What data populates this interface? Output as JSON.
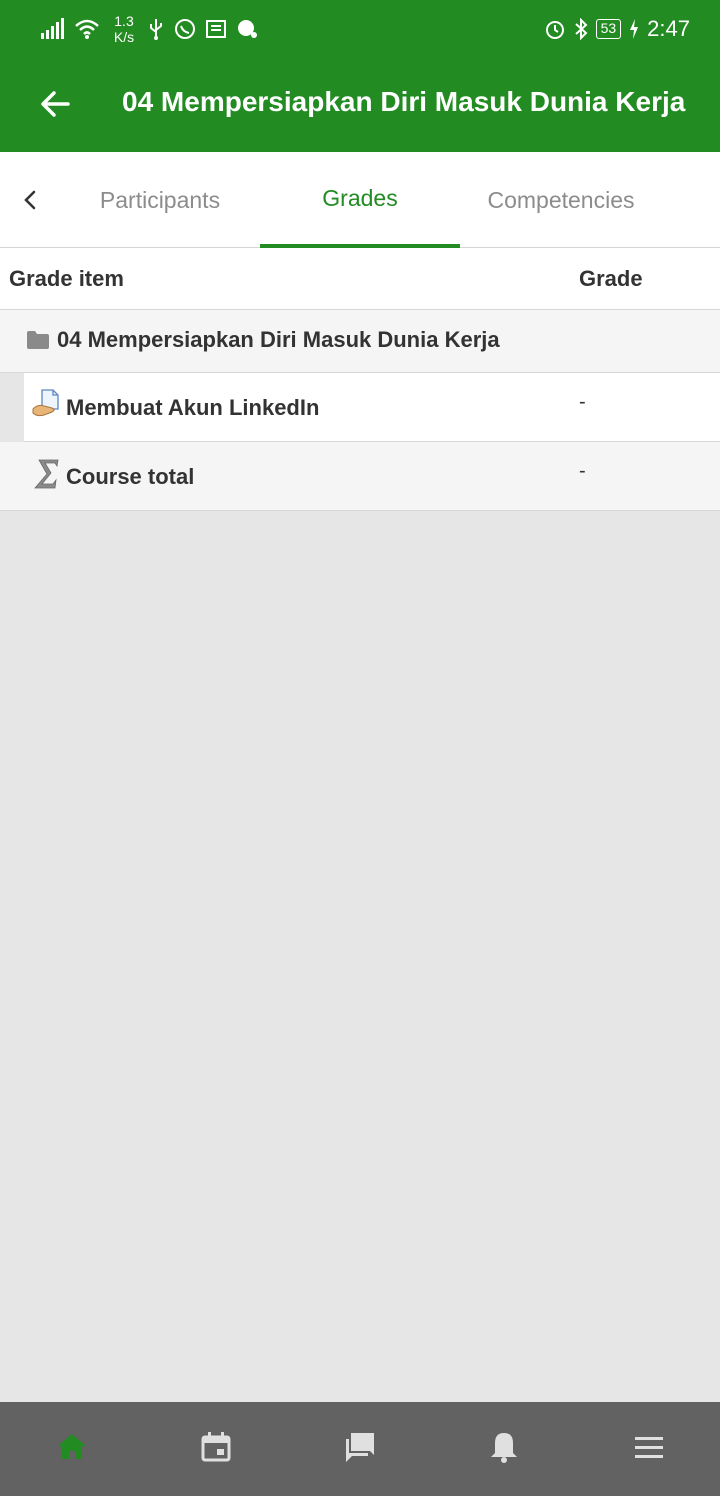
{
  "status_bar": {
    "net_speed_value": "1.3",
    "net_speed_unit": "K/s",
    "battery": "53",
    "time": "2:47",
    "icons_left": [
      "signal-icon",
      "wifi-icon",
      "usb-icon",
      "whatsapp-icon",
      "news-icon",
      "chat-icon"
    ],
    "icons_right": [
      "alarm-icon",
      "bluetooth-icon",
      "battery-icon",
      "charging-icon"
    ]
  },
  "app_bar": {
    "title": "04 Mempersiapkan Diri Masuk Dunia Kerja",
    "back_icon": "arrow-left-icon"
  },
  "tabs": {
    "items": [
      {
        "label": "Participants",
        "active": false
      },
      {
        "label": "Grades",
        "active": true
      },
      {
        "label": "Competencies",
        "active": false
      }
    ]
  },
  "table": {
    "headers": {
      "item": "Grade item",
      "grade": "Grade"
    },
    "rows": [
      {
        "type": "category",
        "icon": "folder-icon",
        "label": "04 Mempersiapkan Diri Masuk Dunia Kerja",
        "grade": ""
      },
      {
        "type": "item",
        "icon": "assignment-icon",
        "label": "Membuat Akun LinkedIn",
        "grade": "-"
      },
      {
        "type": "total",
        "icon": "sigma-icon",
        "label": "Course total",
        "grade": "-"
      }
    ]
  },
  "bottom_nav": {
    "items": [
      "home-icon",
      "calendar-icon",
      "messages-icon",
      "notifications-icon",
      "menu-icon"
    ],
    "active_color": "#228b22",
    "inactive_color": "#e0e0e0"
  },
  "colors": {
    "primary": "#228b22",
    "background": "#e6e6e6",
    "nav_bar": "#626262"
  }
}
